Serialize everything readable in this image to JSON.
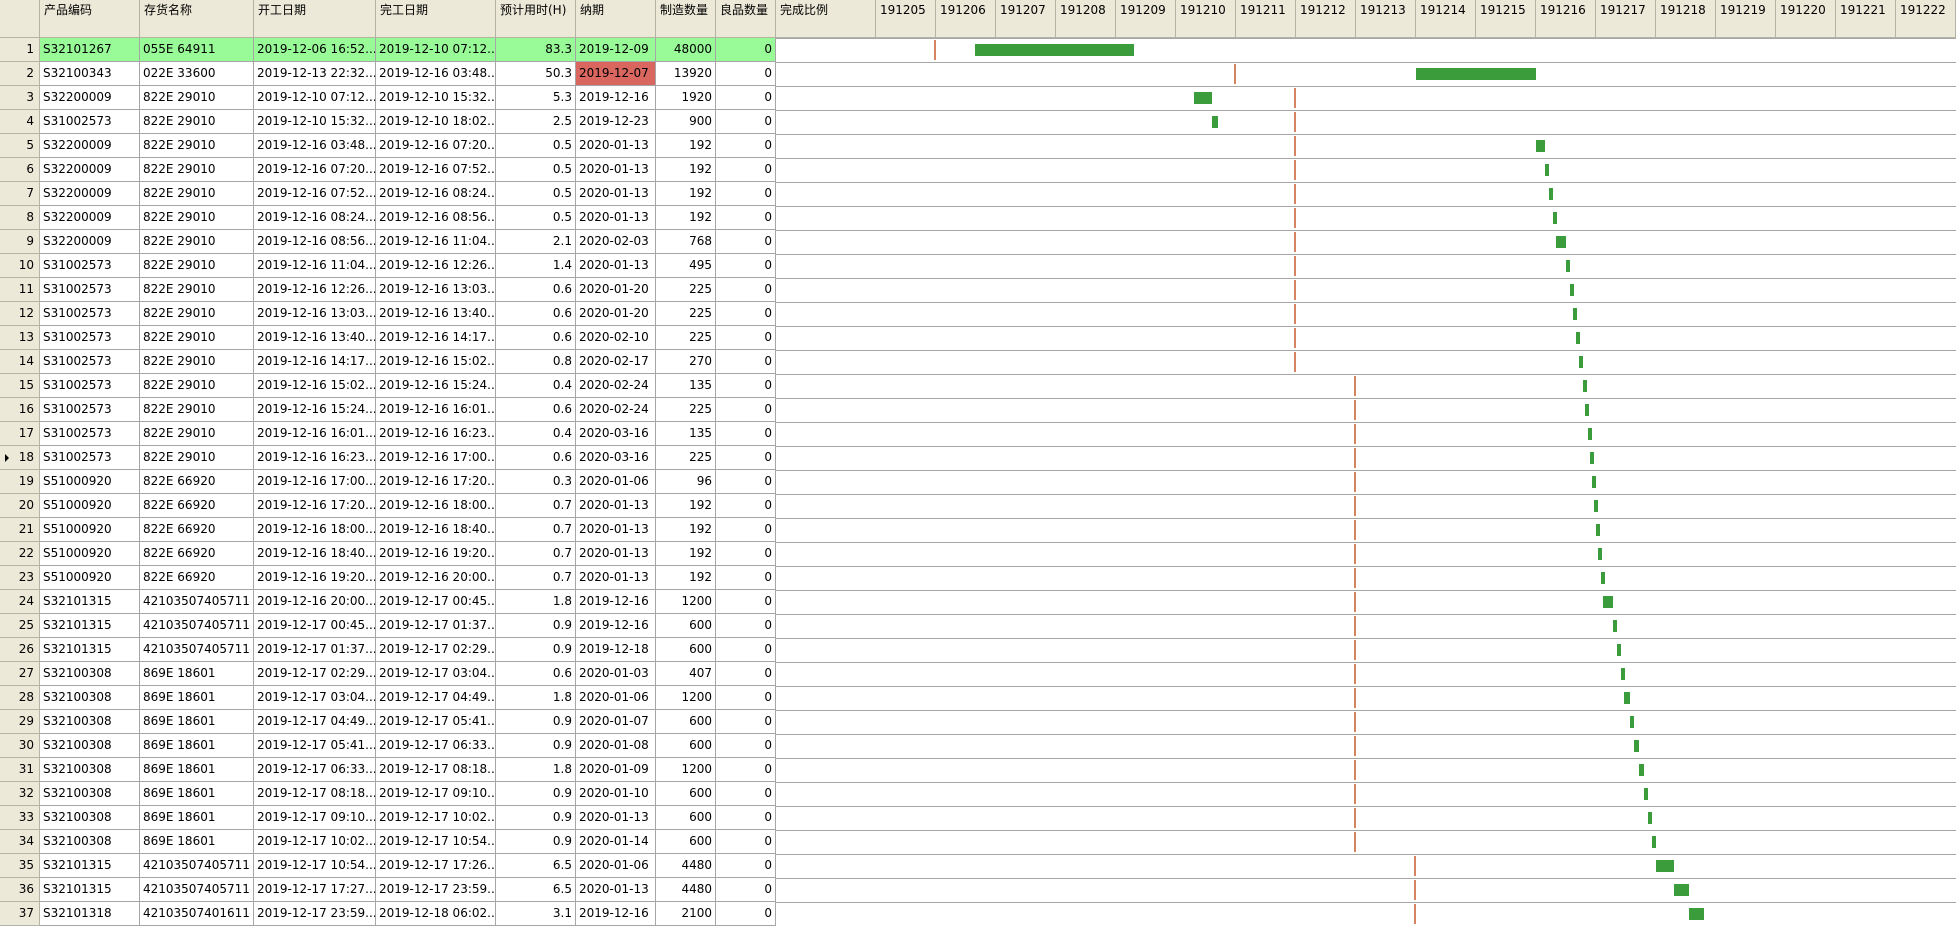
{
  "columns": [
    "产品编码",
    "存货名称",
    "开工日期",
    "完工日期",
    "预计用时(H)",
    "纳期",
    "制造数量",
    "良品数量",
    "完成比例"
  ],
  "timeline": [
    "191205",
    "191206",
    "191207",
    "191208",
    "191209",
    "191210",
    "191211",
    "191212",
    "191213",
    "191214",
    "191215",
    "191216",
    "191217",
    "191218",
    "191219",
    "191220",
    "191221",
    "191222"
  ],
  "selected_row": 0,
  "current_row": 17,
  "colors": {
    "selected_row": "#98fb98",
    "bar": "#3b9c3b",
    "tick": "#d4845e",
    "late_cell": "#d9675f",
    "pending_cell": "#fdb99a"
  },
  "rows": [
    {
      "n": "1",
      "code": "S32101267",
      "name": "055E 64911",
      "start": "2019-12-06 16:52...",
      "end": "2019-12-10 07:12...",
      "hours": "83.3",
      "due": "2019-12-09",
      "qty": "48000",
      "good": "0"
    },
    {
      "n": "2",
      "code": "S32100343",
      "name": "022E 33600",
      "start": "2019-12-13 22:32...",
      "end": "2019-12-16 03:48...",
      "hours": "50.3",
      "due": "2019-12-07",
      "qty": "13920",
      "good": "0"
    },
    {
      "n": "3",
      "code": "S32200009",
      "name": "822E 29010",
      "start": "2019-12-10 07:12...",
      "end": "2019-12-10 15:32...",
      "hours": "5.3",
      "due": "2019-12-16",
      "qty": "1920",
      "good": "0"
    },
    {
      "n": "4",
      "code": "S31002573",
      "name": "822E 29010",
      "start": "2019-12-10 15:32...",
      "end": "2019-12-10 18:02...",
      "hours": "2.5",
      "due": "2019-12-23",
      "qty": "900",
      "good": "0"
    },
    {
      "n": "5",
      "code": "S32200009",
      "name": "822E 29010",
      "start": "2019-12-16 03:48...",
      "end": "2019-12-16 07:20...",
      "hours": "0.5",
      "due": "2020-01-13",
      "qty": "192",
      "good": "0"
    },
    {
      "n": "6",
      "code": "S32200009",
      "name": "822E 29010",
      "start": "2019-12-16 07:20...",
      "end": "2019-12-16 07:52...",
      "hours": "0.5",
      "due": "2020-01-13",
      "qty": "192",
      "good": "0"
    },
    {
      "n": "7",
      "code": "S32200009",
      "name": "822E 29010",
      "start": "2019-12-16 07:52...",
      "end": "2019-12-16 08:24...",
      "hours": "0.5",
      "due": "2020-01-13",
      "qty": "192",
      "good": "0"
    },
    {
      "n": "8",
      "code": "S32200009",
      "name": "822E 29010",
      "start": "2019-12-16 08:24...",
      "end": "2019-12-16 08:56...",
      "hours": "0.5",
      "due": "2020-01-13",
      "qty": "192",
      "good": "0"
    },
    {
      "n": "9",
      "code": "S32200009",
      "name": "822E 29010",
      "start": "2019-12-16 08:56...",
      "end": "2019-12-16 11:04...",
      "hours": "2.1",
      "due": "2020-02-03",
      "qty": "768",
      "good": "0"
    },
    {
      "n": "10",
      "code": "S31002573",
      "name": "822E 29010",
      "start": "2019-12-16 11:04...",
      "end": "2019-12-16 12:26...",
      "hours": "1.4",
      "due": "2020-01-13",
      "qty": "495",
      "good": "0"
    },
    {
      "n": "11",
      "code": "S31002573",
      "name": "822E 29010",
      "start": "2019-12-16 12:26...",
      "end": "2019-12-16 13:03...",
      "hours": "0.6",
      "due": "2020-01-20",
      "qty": "225",
      "good": "0"
    },
    {
      "n": "12",
      "code": "S31002573",
      "name": "822E 29010",
      "start": "2019-12-16 13:03...",
      "end": "2019-12-16 13:40...",
      "hours": "0.6",
      "due": "2020-01-20",
      "qty": "225",
      "good": "0"
    },
    {
      "n": "13",
      "code": "S31002573",
      "name": "822E 29010",
      "start": "2019-12-16 13:40...",
      "end": "2019-12-16 14:17...",
      "hours": "0.6",
      "due": "2020-02-10",
      "qty": "225",
      "good": "0"
    },
    {
      "n": "14",
      "code": "S31002573",
      "name": "822E 29010",
      "start": "2019-12-16 14:17...",
      "end": "2019-12-16 15:02...",
      "hours": "0.8",
      "due": "2020-02-17",
      "qty": "270",
      "good": "0"
    },
    {
      "n": "15",
      "code": "S31002573",
      "name": "822E 29010",
      "start": "2019-12-16 15:02...",
      "end": "2019-12-16 15:24...",
      "hours": "0.4",
      "due": "2020-02-24",
      "qty": "135",
      "good": "0"
    },
    {
      "n": "16",
      "code": "S31002573",
      "name": "822E 29010",
      "start": "2019-12-16 15:24...",
      "end": "2019-12-16 16:01...",
      "hours": "0.6",
      "due": "2020-02-24",
      "qty": "225",
      "good": "0"
    },
    {
      "n": "17",
      "code": "S31002573",
      "name": "822E 29010",
      "start": "2019-12-16 16:01...",
      "end": "2019-12-16 16:23...",
      "hours": "0.4",
      "due": "2020-03-16",
      "qty": "135",
      "good": "0"
    },
    {
      "n": "18",
      "code": "S31002573",
      "name": "822E 29010",
      "start": "2019-12-16 16:23...",
      "end": "2019-12-16 17:00...",
      "hours": "0.6",
      "due": "2020-03-16",
      "qty": "225",
      "good": "0"
    },
    {
      "n": "19",
      "code": "S51000920",
      "name": "822E 66920",
      "start": "2019-12-16 17:00...",
      "end": "2019-12-16 17:20...",
      "hours": "0.3",
      "due": "2020-01-06",
      "qty": "96",
      "good": "0"
    },
    {
      "n": "20",
      "code": "S51000920",
      "name": "822E 66920",
      "start": "2019-12-16 17:20...",
      "end": "2019-12-16 18:00...",
      "hours": "0.7",
      "due": "2020-01-13",
      "qty": "192",
      "good": "0"
    },
    {
      "n": "21",
      "code": "S51000920",
      "name": "822E 66920",
      "start": "2019-12-16 18:00...",
      "end": "2019-12-16 18:40...",
      "hours": "0.7",
      "due": "2020-01-13",
      "qty": "192",
      "good": "0"
    },
    {
      "n": "22",
      "code": "S51000920",
      "name": "822E 66920",
      "start": "2019-12-16 18:40...",
      "end": "2019-12-16 19:20...",
      "hours": "0.7",
      "due": "2020-01-13",
      "qty": "192",
      "good": "0"
    },
    {
      "n": "23",
      "code": "S51000920",
      "name": "822E 66920",
      "start": "2019-12-16 19:20...",
      "end": "2019-12-16 20:00...",
      "hours": "0.7",
      "due": "2020-01-13",
      "qty": "192",
      "good": "0"
    },
    {
      "n": "24",
      "code": "S32101315",
      "name": "42103507405711",
      "start": "2019-12-16 20:00...",
      "end": "2019-12-17 00:45...",
      "hours": "1.8",
      "due": "2019-12-16",
      "qty": "1200",
      "good": "0"
    },
    {
      "n": "25",
      "code": "S32101315",
      "name": "42103507405711",
      "start": "2019-12-17 00:45...",
      "end": "2019-12-17 01:37...",
      "hours": "0.9",
      "due": "2019-12-16",
      "qty": "600",
      "good": "0"
    },
    {
      "n": "26",
      "code": "S32101315",
      "name": "42103507405711",
      "start": "2019-12-17 01:37...",
      "end": "2019-12-17 02:29...",
      "hours": "0.9",
      "due": "2019-12-18",
      "qty": "600",
      "good": "0"
    },
    {
      "n": "27",
      "code": "S32100308",
      "name": "869E 18601",
      "start": "2019-12-17 02:29...",
      "end": "2019-12-17 03:04...",
      "hours": "0.6",
      "due": "2020-01-03",
      "qty": "407",
      "good": "0"
    },
    {
      "n": "28",
      "code": "S32100308",
      "name": "869E 18601",
      "start": "2019-12-17 03:04...",
      "end": "2019-12-17 04:49...",
      "hours": "1.8",
      "due": "2020-01-06",
      "qty": "1200",
      "good": "0"
    },
    {
      "n": "29",
      "code": "S32100308",
      "name": "869E 18601",
      "start": "2019-12-17 04:49...",
      "end": "2019-12-17 05:41...",
      "hours": "0.9",
      "due": "2020-01-07",
      "qty": "600",
      "good": "0"
    },
    {
      "n": "30",
      "code": "S32100308",
      "name": "869E 18601",
      "start": "2019-12-17 05:41...",
      "end": "2019-12-17 06:33...",
      "hours": "0.9",
      "due": "2020-01-08",
      "qty": "600",
      "good": "0"
    },
    {
      "n": "31",
      "code": "S32100308",
      "name": "869E 18601",
      "start": "2019-12-17 06:33...",
      "end": "2019-12-17 08:18...",
      "hours": "1.8",
      "due": "2020-01-09",
      "qty": "1200",
      "good": "0"
    },
    {
      "n": "32",
      "code": "S32100308",
      "name": "869E 18601",
      "start": "2019-12-17 08:18...",
      "end": "2019-12-17 09:10...",
      "hours": "0.9",
      "due": "2020-01-10",
      "qty": "600",
      "good": "0"
    },
    {
      "n": "33",
      "code": "S32100308",
      "name": "869E 18601",
      "start": "2019-12-17 09:10...",
      "end": "2019-12-17 10:02...",
      "hours": "0.9",
      "due": "2020-01-13",
      "qty": "600",
      "good": "0"
    },
    {
      "n": "34",
      "code": "S32100308",
      "name": "869E 18601",
      "start": "2019-12-17 10:02...",
      "end": "2019-12-17 10:54...",
      "hours": "0.9",
      "due": "2020-01-14",
      "qty": "600",
      "good": "0"
    },
    {
      "n": "35",
      "code": "S32101315",
      "name": "42103507405711",
      "start": "2019-12-17 10:54...",
      "end": "2019-12-17 17:26...",
      "hours": "6.5",
      "due": "2020-01-06",
      "qty": "4480",
      "good": "0"
    },
    {
      "n": "36",
      "code": "S32101315",
      "name": "42103507405711",
      "start": "2019-12-17 17:27...",
      "end": "2019-12-17 23:59...",
      "hours": "6.5",
      "due": "2020-01-13",
      "qty": "4480",
      "good": "0"
    },
    {
      "n": "37",
      "code": "S32101318",
      "name": "42103507401611",
      "start": "2019-12-17 23:59...",
      "end": "2019-12-18 06:02...",
      "hours": "3.1",
      "due": "2019-12-16",
      "qty": "2100",
      "good": "0"
    }
  ],
  "gantt": [
    {
      "bar": [
        1.65,
        4.3
      ],
      "tick": 1.0
    },
    {
      "bar": [
        9.0,
        11.0
      ],
      "tick": 6.0
    },
    {
      "bar": [
        5.3,
        5.6
      ],
      "tick": 7.0
    },
    {
      "bar": [
        5.6,
        5.7
      ],
      "tick": 7.0
    },
    {
      "bar": [
        11.0,
        11.15
      ],
      "tick": 7.0
    },
    {
      "bar": [
        11.15,
        11.22
      ],
      "tick": 7.0
    },
    {
      "bar": [
        11.22,
        11.28
      ],
      "tick": 7.0
    },
    {
      "bar": [
        11.28,
        11.34
      ],
      "tick": 7.0
    },
    {
      "bar": [
        11.34,
        11.5
      ],
      "tick": 7.0
    },
    {
      "bar": [
        11.5,
        11.57
      ],
      "tick": 7.0
    },
    {
      "bar": [
        11.57,
        11.62
      ],
      "tick": 7.0
    },
    {
      "bar": [
        11.62,
        11.67
      ],
      "tick": 7.0
    },
    {
      "bar": [
        11.67,
        11.72
      ],
      "tick": 7.0
    },
    {
      "bar": [
        11.72,
        11.78
      ],
      "tick": 7.0
    },
    {
      "bar": [
        11.78,
        11.82
      ],
      "tick": 8.0
    },
    {
      "bar": [
        11.82,
        11.86
      ],
      "tick": 8.0
    },
    {
      "bar": [
        11.86,
        11.9
      ],
      "tick": 8.0
    },
    {
      "bar": [
        11.9,
        11.94
      ],
      "tick": 8.0,
      "pending": true
    },
    {
      "bar": [
        11.94,
        11.97
      ],
      "tick": 8.0
    },
    {
      "bar": [
        11.97,
        12.0
      ],
      "tick": 8.0
    },
    {
      "bar": [
        12.0,
        12.04
      ],
      "tick": 8.0
    },
    {
      "bar": [
        12.04,
        12.08
      ],
      "tick": 8.0
    },
    {
      "bar": [
        12.08,
        12.12
      ],
      "tick": 8.0
    },
    {
      "bar": [
        12.12,
        12.28
      ],
      "tick": 8.0
    },
    {
      "bar": [
        12.28,
        12.35
      ],
      "tick": 8.0
    },
    {
      "bar": [
        12.35,
        12.42
      ],
      "tick": 8.0
    },
    {
      "bar": [
        12.42,
        12.47
      ],
      "tick": 8.0
    },
    {
      "bar": [
        12.47,
        12.57
      ],
      "tick": 8.0
    },
    {
      "bar": [
        12.57,
        12.64
      ],
      "tick": 8.0
    },
    {
      "bar": [
        12.64,
        12.71
      ],
      "tick": 8.0
    },
    {
      "bar": [
        12.71,
        12.8
      ],
      "tick": 8.0
    },
    {
      "bar": [
        12.8,
        12.87
      ],
      "tick": 8.0
    },
    {
      "bar": [
        12.87,
        12.94
      ],
      "tick": 8.0
    },
    {
      "bar": [
        12.94,
        13.0
      ],
      "tick": 8.0
    },
    {
      "bar": [
        13.0,
        13.3
      ],
      "tick": 9.0
    },
    {
      "bar": [
        13.3,
        13.55
      ],
      "tick": 9.0
    },
    {
      "bar": [
        13.55,
        13.8
      ],
      "tick": 9.0
    }
  ]
}
